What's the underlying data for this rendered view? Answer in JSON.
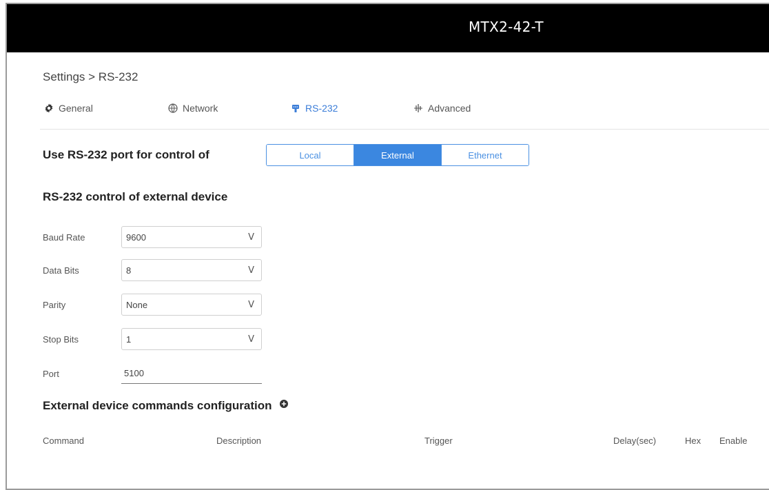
{
  "window": {
    "title": "MTX2-42-T"
  },
  "breadcrumb": "Settings > RS-232",
  "tabs": [
    {
      "label": "General",
      "icon": "gear-icon"
    },
    {
      "label": "Network",
      "icon": "network-icon"
    },
    {
      "label": "RS-232",
      "icon": "rs232-icon",
      "active": true
    },
    {
      "label": "Advanced",
      "icon": "advanced-icon"
    }
  ],
  "control": {
    "label": "Use RS-232 port for control of",
    "options": [
      "Local",
      "External",
      "Ethernet"
    ],
    "selected": "External"
  },
  "external": {
    "title": "RS-232 control of external device",
    "fields": {
      "baud_rate": {
        "label": "Baud Rate",
        "value": "9600"
      },
      "data_bits": {
        "label": "Data Bits",
        "value": "8"
      },
      "parity": {
        "label": "Parity",
        "value": "None"
      },
      "stop_bits": {
        "label": "Stop Bits",
        "value": "1"
      },
      "port": {
        "label": "Port",
        "value": "5100"
      }
    },
    "chevron": "V"
  },
  "commands": {
    "title": "External device commands configuration",
    "columns": [
      "Command",
      "Description",
      "Trigger",
      "Delay(sec)",
      "Hex",
      "Enable"
    ]
  },
  "colors": {
    "accent": "#3b87e0",
    "titlebar": "#000000"
  }
}
